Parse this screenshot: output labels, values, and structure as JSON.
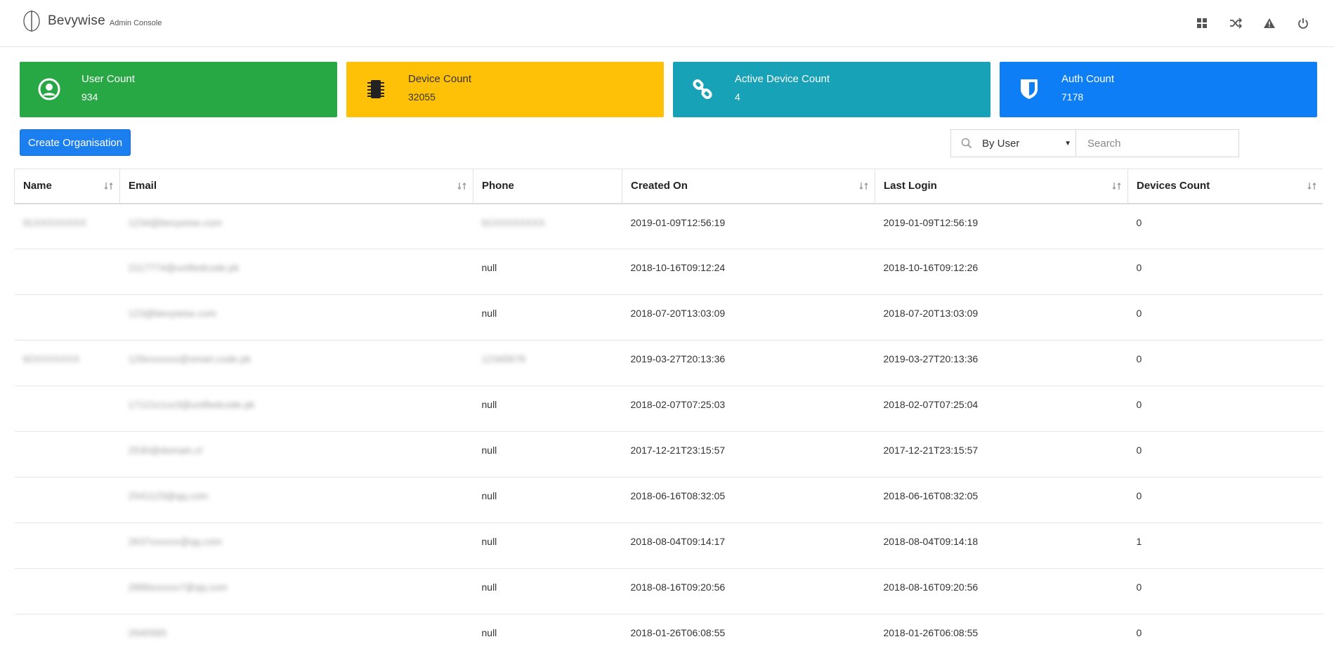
{
  "header": {
    "brand_name": "Bevywise",
    "brand_sub": "Admin Console",
    "icons": [
      "grid-icon",
      "shuffle-icon",
      "alert-icon",
      "power-icon"
    ]
  },
  "cards": [
    {
      "label": "User Count",
      "value": "934",
      "color": "#28a745",
      "icon": "user-icon"
    },
    {
      "label": "Device Count",
      "value": "32055",
      "color": "#ffc107",
      "icon": "chip-icon"
    },
    {
      "label": "Active Device Count",
      "value": "4",
      "color": "#17a2b8",
      "icon": "link-icon"
    },
    {
      "label": "Auth Count",
      "value": "7178",
      "color": "#0d7ef6",
      "icon": "shield-icon"
    }
  ],
  "toolbar": {
    "create_label": "Create Organisation",
    "filter_selected": "By User",
    "search_placeholder": "Search"
  },
  "table": {
    "columns": [
      "Name",
      "Email",
      "Phone",
      "Created On",
      "Last Login",
      "Devices Count"
    ],
    "rows": [
      {
        "name": "91XXXXXXXX",
        "email": "1234@bevywise.com",
        "phone": "91XXXXXXXX",
        "created": "2019-01-09T12:56:19",
        "last_login": "2019-01-09T12:56:19",
        "devices": "0"
      },
      {
        "name": "",
        "email": "2117774@unifiedcode.pk",
        "phone": "null",
        "created": "2018-10-16T09:12:24",
        "last_login": "2018-10-16T09:12:26",
        "devices": "0"
      },
      {
        "name": "",
        "email": "123@bevywise.com",
        "phone": "null",
        "created": "2018-07-20T13:03:09",
        "last_login": "2018-07-20T13:03:09",
        "devices": "0"
      },
      {
        "name": "92XXXXXXX",
        "email": "129xxxxxxx@smart.code.pk",
        "phone": "12345678",
        "created": "2019-03-27T20:13:36",
        "last_login": "2019-03-27T20:13:36",
        "devices": "0"
      },
      {
        "name": "",
        "email": "17121x1xx3@unifiedcode.pk",
        "phone": "null",
        "created": "2018-02-07T07:25:03",
        "last_login": "2018-02-07T07:25:04",
        "devices": "0"
      },
      {
        "name": "",
        "email": "2530@domain.cl",
        "phone": "null",
        "created": "2017-12-21T23:15:57",
        "last_login": "2017-12-21T23:15:57",
        "devices": "0"
      },
      {
        "name": "",
        "email": "2541123@qq.com",
        "phone": "null",
        "created": "2018-06-16T08:32:05",
        "last_login": "2018-06-16T08:32:05",
        "devices": "0"
      },
      {
        "name": "",
        "email": "2637xxxxxx@qq.com",
        "phone": "null",
        "created": "2018-08-04T09:14:17",
        "last_login": "2018-08-04T09:14:18",
        "devices": "1"
      },
      {
        "name": "",
        "email": "2889xxxxxx7@qq.com",
        "phone": "null",
        "created": "2018-08-16T09:20:56",
        "last_login": "2018-08-16T09:20:56",
        "devices": "0"
      },
      {
        "name": "",
        "email": "2940565",
        "phone": "null",
        "created": "2018-01-26T06:08:55",
        "last_login": "2018-01-26T06:08:55",
        "devices": "0"
      }
    ]
  }
}
